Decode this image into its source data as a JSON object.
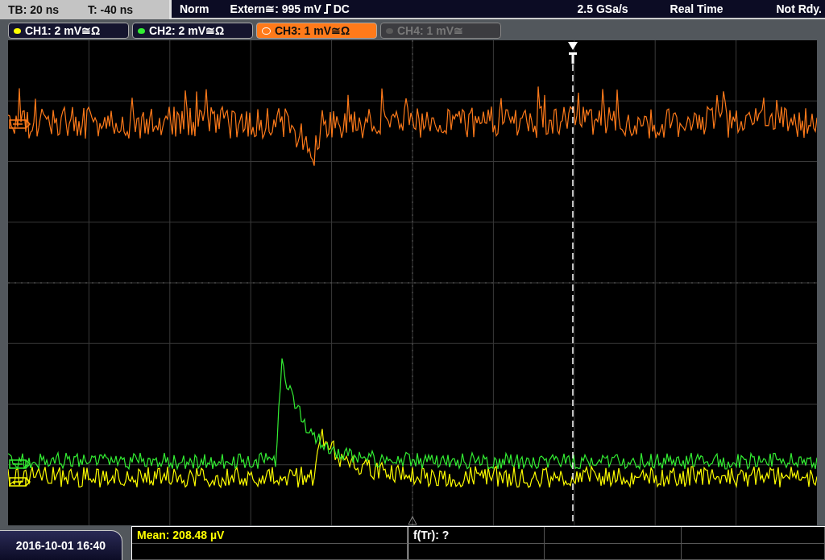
{
  "header": {
    "timebase": "TB: 20 ns",
    "trigger_offset": "T: -40 ns",
    "trigger_mode": "Norm",
    "trigger_source": "Extern≅: 995 mV",
    "trigger_coupling": "DC",
    "sample_rate": "2.5 GSa/s",
    "acquisition": "Real Time",
    "status": "Not Rdy."
  },
  "channels": [
    {
      "label": "CH1: 2 mV≅Ω",
      "color": "#ffff00",
      "selected": false,
      "enabled": true
    },
    {
      "label": "CH2: 2 mV≅Ω",
      "color": "#33ee33",
      "selected": false,
      "enabled": true
    },
    {
      "label": "CH3: 1 mV≅Ω",
      "color": "#ff7a1a",
      "selected": true,
      "enabled": true
    },
    {
      "label": "CH4: 1 mV≅",
      "color": "#5a5a5a",
      "selected": false,
      "enabled": false
    }
  ],
  "measurements": [
    {
      "text": "Mean: 208.48 µV",
      "color": "#ffff00"
    },
    {
      "text": "f(Tr): ?",
      "color": "#ffffff"
    }
  ],
  "date": "2016-10-01 16:40"
}
